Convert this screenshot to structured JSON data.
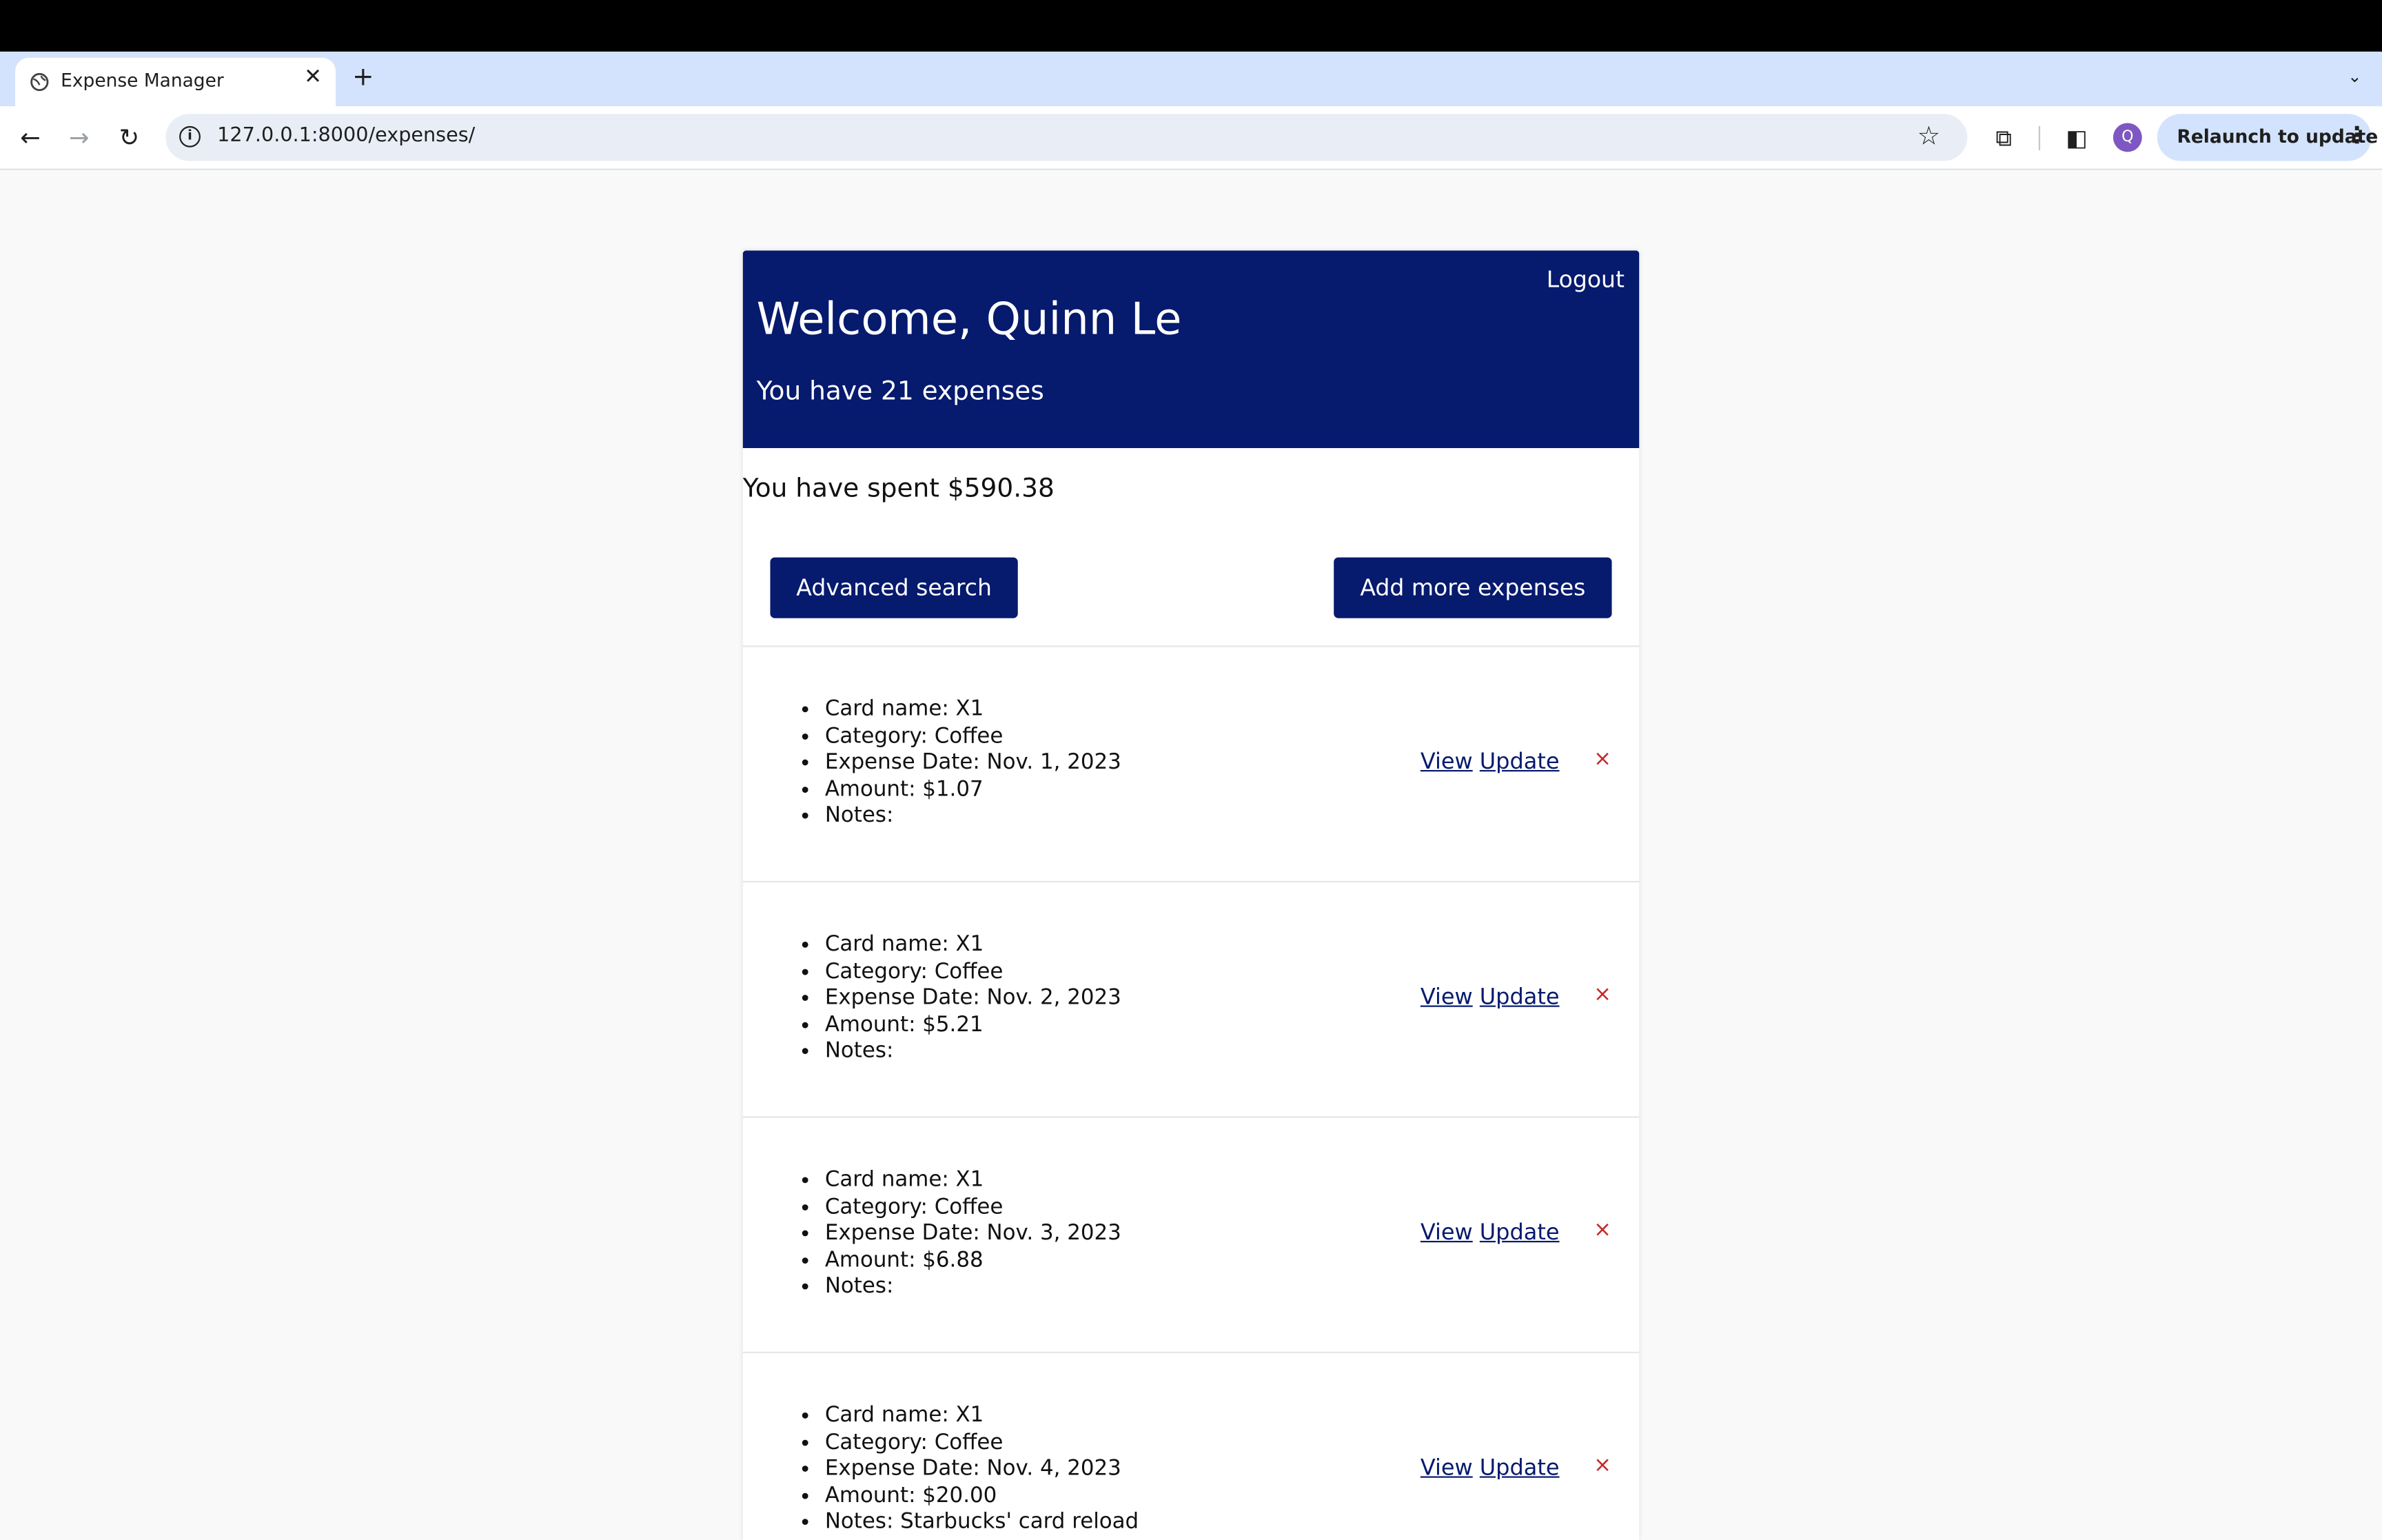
{
  "browser": {
    "tab_title": "Expense Manager",
    "url": "127.0.0.1:8000/expenses/",
    "avatar_initial": "Q",
    "relaunch_label": "Relaunch to update"
  },
  "header": {
    "logout": "Logout",
    "welcome": "Welcome, Quinn Le",
    "count_text": "You have 21 expenses"
  },
  "summary": {
    "spent_text": "You have spent $590.38"
  },
  "buttons": {
    "advanced_search": "Advanced search",
    "add_more": "Add more expenses"
  },
  "actions": {
    "view": "View",
    "update": "Update",
    "delete": "×"
  },
  "expenses": [
    {
      "card": "Card name: X1",
      "category": "Category: Coffee",
      "date": "Expense Date: Nov. 1, 2023",
      "amount": "Amount: $1.07",
      "notes": "Notes:"
    },
    {
      "card": "Card name: X1",
      "category": "Category: Coffee",
      "date": "Expense Date: Nov. 2, 2023",
      "amount": "Amount: $5.21",
      "notes": "Notes:"
    },
    {
      "card": "Card name: X1",
      "category": "Category: Coffee",
      "date": "Expense Date: Nov. 3, 2023",
      "amount": "Amount: $6.88",
      "notes": "Notes:"
    },
    {
      "card": "Card name: X1",
      "category": "Category: Coffee",
      "date": "Expense Date: Nov. 4, 2023",
      "amount": "Amount: $20.00",
      "notes": "Notes: Starbucks' card reload"
    }
  ]
}
